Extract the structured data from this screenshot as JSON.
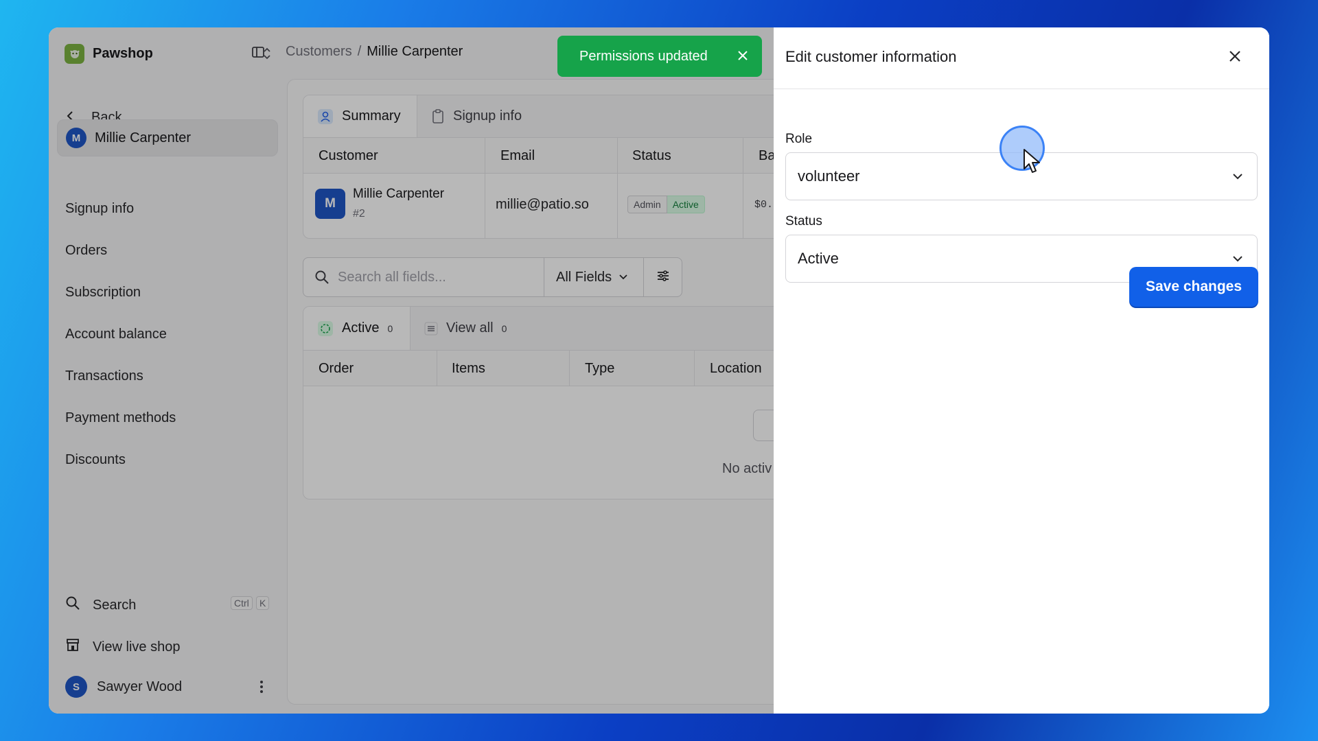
{
  "app": {
    "name": "Pawshop"
  },
  "breadcrumb": {
    "parent": "Customers",
    "separator": "/",
    "current": "Millie Carpenter"
  },
  "toast": {
    "message": "Permissions updated"
  },
  "sidebar": {
    "back_label": "Back",
    "active_item": {
      "avatar_initial": "M",
      "label": "Millie Carpenter"
    },
    "items": [
      {
        "label": "Signup info"
      },
      {
        "label": "Orders"
      },
      {
        "label": "Subscription"
      },
      {
        "label": "Account balance"
      },
      {
        "label": "Transactions"
      },
      {
        "label": "Payment methods"
      },
      {
        "label": "Discounts"
      }
    ],
    "search_label": "Search",
    "search_shortcut": [
      "Ctrl",
      "K"
    ],
    "live_shop_label": "View live shop",
    "user": {
      "initial": "S",
      "name": "Sawyer Wood"
    }
  },
  "summary_card": {
    "tabs": [
      {
        "label": "Summary"
      },
      {
        "label": "Signup info"
      }
    ],
    "columns": [
      "Customer",
      "Email",
      "Status",
      "Ba"
    ],
    "row": {
      "avatar_initial": "M",
      "name": "Millie Carpenter",
      "id": "#2",
      "email": "millie@patio.so",
      "badges": [
        "Admin",
        "Active"
      ],
      "balance": "$0."
    }
  },
  "search": {
    "placeholder": "Search all fields...",
    "filter_label": "All Fields"
  },
  "orders_card": {
    "tabs": [
      {
        "label": "Active",
        "count": "0"
      },
      {
        "label": "View all",
        "count": "0"
      }
    ],
    "columns": [
      "Order",
      "Items",
      "Type",
      "Location"
    ],
    "empty_text": "No activ"
  },
  "drawer": {
    "title": "Edit customer information",
    "role": {
      "label": "Role",
      "value": "volunteer"
    },
    "status": {
      "label": "Status",
      "value": "Active"
    },
    "save_label": "Save changes"
  },
  "colors": {
    "toast_bg": "#16a34a",
    "primary_button": "#1160e8",
    "avatar": "#1f56c7",
    "active_badge": "#dcfce7"
  }
}
